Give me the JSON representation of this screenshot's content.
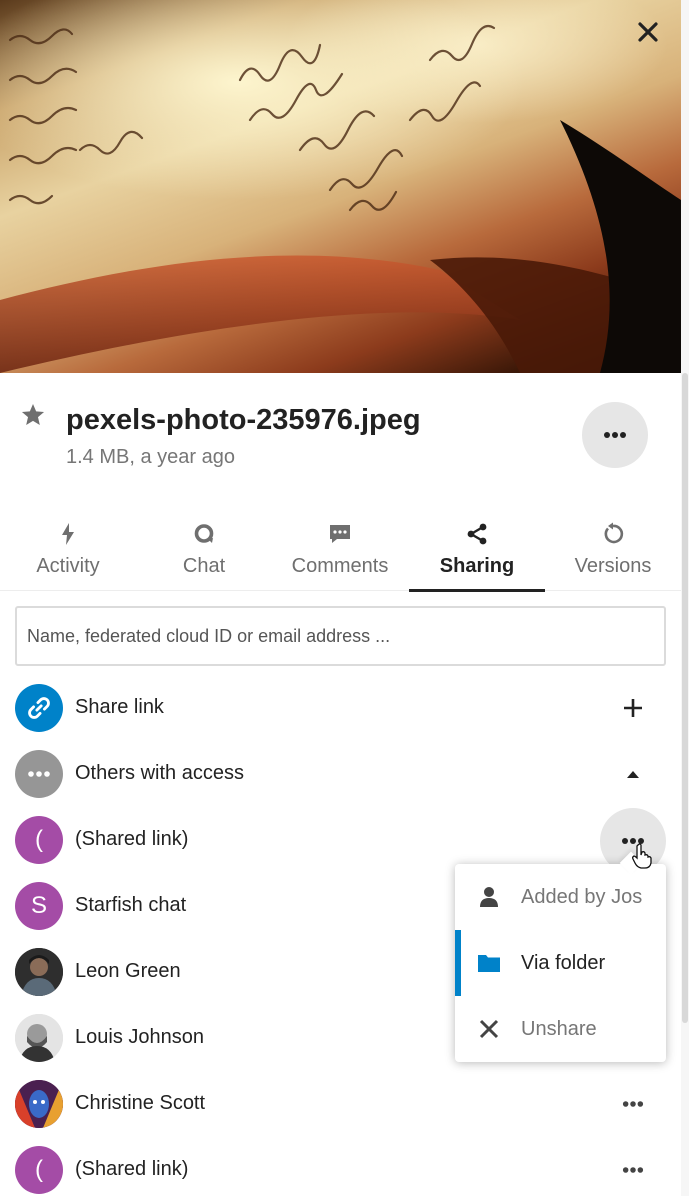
{
  "file": {
    "name": "pexels-photo-235976.jpeg",
    "meta": "1.4 MB, a year ago"
  },
  "tabs": [
    {
      "label": "Activity",
      "icon": "bolt-icon"
    },
    {
      "label": "Chat",
      "icon": "chat-icon"
    },
    {
      "label": "Comments",
      "icon": "comments-icon"
    },
    {
      "label": "Sharing",
      "icon": "share-icon",
      "active": true
    },
    {
      "label": "Versions",
      "icon": "history-icon"
    }
  ],
  "search": {
    "placeholder": "Name, federated cloud ID or email address ..."
  },
  "shares": {
    "share_link": "Share link",
    "others": "Others with access",
    "items": [
      {
        "label": "(Shared link)",
        "avatar_letter": "("
      },
      {
        "label": "Starfish chat",
        "avatar_letter": "S"
      },
      {
        "label": "Leon Green"
      },
      {
        "label": "Louis Johnson"
      },
      {
        "label": "Christine Scott"
      },
      {
        "label": "(Shared link)",
        "avatar_letter": "("
      }
    ]
  },
  "menu": {
    "items": [
      {
        "label": "Added by Jos",
        "icon": "user-icon"
      },
      {
        "label": "Via folder",
        "icon": "folder-icon",
        "active": true
      },
      {
        "label": "Unshare",
        "icon": "close-icon"
      }
    ]
  },
  "colors": {
    "primary": "#0082c9",
    "avatar_purple": "#a44ca6",
    "avatar_gray": "#969696"
  }
}
